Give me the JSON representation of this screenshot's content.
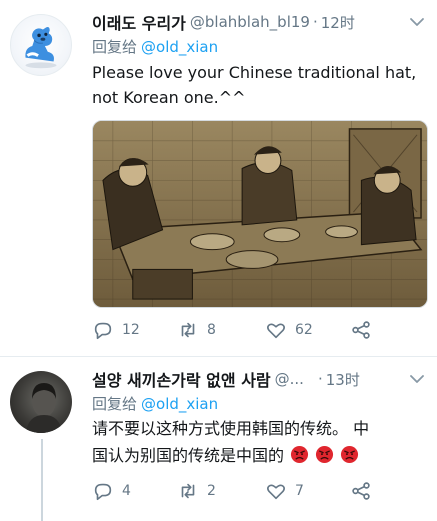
{
  "tweets": [
    {
      "display_name": "이래도 우리가",
      "handle": "@blahblah_bl19",
      "separator": "·",
      "time": "12时",
      "reply_prefix": "回复给",
      "reply_to": "@old_xian",
      "text_lines": [
        "Please love your Chinese traditional hat,",
        "not Korean one.^^"
      ],
      "avatar_icon": "blue-dog-plush-avatar",
      "media_description_icon": "qing-dynasty-banquet-painting",
      "counts": {
        "replies": "12",
        "retweets": "8",
        "likes": "62"
      }
    },
    {
      "display_name": "설양 새끼손가락 없앤 사람",
      "handle": "@...",
      "separator": "·",
      "time": "13时",
      "reply_prefix": "回复给",
      "reply_to": "@old_xian",
      "text_lines": [
        "请不要以这种方式使用韩国的传统。 中",
        "国认为别国的传统是中国的"
      ],
      "emojis": [
        "angry-face-emoji",
        "angry-face-emoji",
        "angry-face-emoji"
      ],
      "avatar_icon": "dark-portrait-avatar",
      "counts": {
        "replies": "4",
        "retweets": "2",
        "likes": "7"
      }
    }
  ],
  "colors": {
    "text": "#14171a",
    "secondary": "#657786",
    "link": "#1da1f2",
    "divider": "#e6ecf0",
    "emoji_red": "#e0262e"
  },
  "icons": {
    "reply": "speech-bubble-icon",
    "retweet": "retweet-arrows-icon",
    "like": "heart-icon",
    "share": "share-nodes-icon",
    "menu": "chevron-down-icon"
  }
}
